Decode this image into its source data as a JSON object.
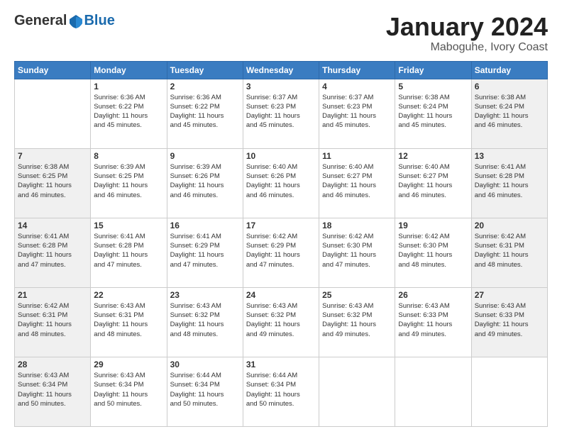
{
  "header": {
    "logo_general": "General",
    "logo_blue": "Blue",
    "month_title": "January 2024",
    "location": "Maboguhe, Ivory Coast"
  },
  "days_of_week": [
    "Sunday",
    "Monday",
    "Tuesday",
    "Wednesday",
    "Thursday",
    "Friday",
    "Saturday"
  ],
  "weeks": [
    [
      {
        "day": "",
        "info": ""
      },
      {
        "day": "1",
        "info": "Sunrise: 6:36 AM\nSunset: 6:22 PM\nDaylight: 11 hours\nand 45 minutes."
      },
      {
        "day": "2",
        "info": "Sunrise: 6:36 AM\nSunset: 6:22 PM\nDaylight: 11 hours\nand 45 minutes."
      },
      {
        "day": "3",
        "info": "Sunrise: 6:37 AM\nSunset: 6:23 PM\nDaylight: 11 hours\nand 45 minutes."
      },
      {
        "day": "4",
        "info": "Sunrise: 6:37 AM\nSunset: 6:23 PM\nDaylight: 11 hours\nand 45 minutes."
      },
      {
        "day": "5",
        "info": "Sunrise: 6:38 AM\nSunset: 6:24 PM\nDaylight: 11 hours\nand 45 minutes."
      },
      {
        "day": "6",
        "info": "Sunrise: 6:38 AM\nSunset: 6:24 PM\nDaylight: 11 hours\nand 46 minutes."
      }
    ],
    [
      {
        "day": "7",
        "info": "Sunrise: 6:38 AM\nSunset: 6:25 PM\nDaylight: 11 hours\nand 46 minutes."
      },
      {
        "day": "8",
        "info": "Sunrise: 6:39 AM\nSunset: 6:25 PM\nDaylight: 11 hours\nand 46 minutes."
      },
      {
        "day": "9",
        "info": "Sunrise: 6:39 AM\nSunset: 6:26 PM\nDaylight: 11 hours\nand 46 minutes."
      },
      {
        "day": "10",
        "info": "Sunrise: 6:40 AM\nSunset: 6:26 PM\nDaylight: 11 hours\nand 46 minutes."
      },
      {
        "day": "11",
        "info": "Sunrise: 6:40 AM\nSunset: 6:27 PM\nDaylight: 11 hours\nand 46 minutes."
      },
      {
        "day": "12",
        "info": "Sunrise: 6:40 AM\nSunset: 6:27 PM\nDaylight: 11 hours\nand 46 minutes."
      },
      {
        "day": "13",
        "info": "Sunrise: 6:41 AM\nSunset: 6:28 PM\nDaylight: 11 hours\nand 46 minutes."
      }
    ],
    [
      {
        "day": "14",
        "info": "Sunrise: 6:41 AM\nSunset: 6:28 PM\nDaylight: 11 hours\nand 47 minutes."
      },
      {
        "day": "15",
        "info": "Sunrise: 6:41 AM\nSunset: 6:28 PM\nDaylight: 11 hours\nand 47 minutes."
      },
      {
        "day": "16",
        "info": "Sunrise: 6:41 AM\nSunset: 6:29 PM\nDaylight: 11 hours\nand 47 minutes."
      },
      {
        "day": "17",
        "info": "Sunrise: 6:42 AM\nSunset: 6:29 PM\nDaylight: 11 hours\nand 47 minutes."
      },
      {
        "day": "18",
        "info": "Sunrise: 6:42 AM\nSunset: 6:30 PM\nDaylight: 11 hours\nand 47 minutes."
      },
      {
        "day": "19",
        "info": "Sunrise: 6:42 AM\nSunset: 6:30 PM\nDaylight: 11 hours\nand 48 minutes."
      },
      {
        "day": "20",
        "info": "Sunrise: 6:42 AM\nSunset: 6:31 PM\nDaylight: 11 hours\nand 48 minutes."
      }
    ],
    [
      {
        "day": "21",
        "info": "Sunrise: 6:42 AM\nSunset: 6:31 PM\nDaylight: 11 hours\nand 48 minutes."
      },
      {
        "day": "22",
        "info": "Sunrise: 6:43 AM\nSunset: 6:31 PM\nDaylight: 11 hours\nand 48 minutes."
      },
      {
        "day": "23",
        "info": "Sunrise: 6:43 AM\nSunset: 6:32 PM\nDaylight: 11 hours\nand 48 minutes."
      },
      {
        "day": "24",
        "info": "Sunrise: 6:43 AM\nSunset: 6:32 PM\nDaylight: 11 hours\nand 49 minutes."
      },
      {
        "day": "25",
        "info": "Sunrise: 6:43 AM\nSunset: 6:32 PM\nDaylight: 11 hours\nand 49 minutes."
      },
      {
        "day": "26",
        "info": "Sunrise: 6:43 AM\nSunset: 6:33 PM\nDaylight: 11 hours\nand 49 minutes."
      },
      {
        "day": "27",
        "info": "Sunrise: 6:43 AM\nSunset: 6:33 PM\nDaylight: 11 hours\nand 49 minutes."
      }
    ],
    [
      {
        "day": "28",
        "info": "Sunrise: 6:43 AM\nSunset: 6:34 PM\nDaylight: 11 hours\nand 50 minutes."
      },
      {
        "day": "29",
        "info": "Sunrise: 6:43 AM\nSunset: 6:34 PM\nDaylight: 11 hours\nand 50 minutes."
      },
      {
        "day": "30",
        "info": "Sunrise: 6:44 AM\nSunset: 6:34 PM\nDaylight: 11 hours\nand 50 minutes."
      },
      {
        "day": "31",
        "info": "Sunrise: 6:44 AM\nSunset: 6:34 PM\nDaylight: 11 hours\nand 50 minutes."
      },
      {
        "day": "",
        "info": ""
      },
      {
        "day": "",
        "info": ""
      },
      {
        "day": "",
        "info": ""
      }
    ]
  ]
}
